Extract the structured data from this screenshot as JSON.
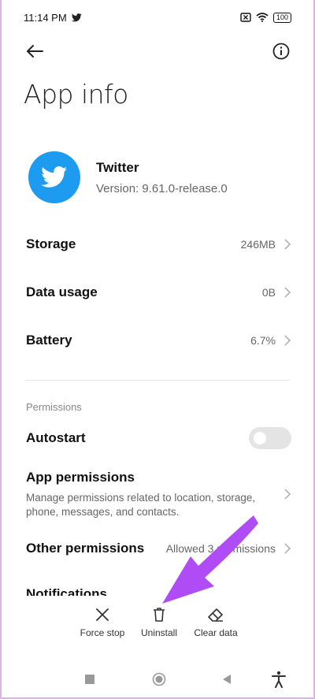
{
  "status_bar": {
    "time": "11:14 PM",
    "battery": "100",
    "icons": [
      "twitter-bird-icon",
      "sim-crossed-icon",
      "wifi-icon",
      "battery-icon"
    ]
  },
  "top_bar": {
    "back_icon": "arrow-left-icon",
    "info_icon": "info-circle-icon"
  },
  "page_title": "App info",
  "app": {
    "name": "Twitter",
    "version": "Version: 9.61.0-release.0",
    "icon": "twitter-bird-icon",
    "icon_color": "#1d9bf0"
  },
  "rows": {
    "storage": {
      "label": "Storage",
      "value": "246MB"
    },
    "data_usage": {
      "label": "Data usage",
      "value": "0B"
    },
    "battery": {
      "label": "Battery",
      "value": "6.7%"
    }
  },
  "permissions": {
    "section_label": "Permissions",
    "autostart": {
      "label": "Autostart",
      "enabled": false
    },
    "app_permissions": {
      "label": "App permissions",
      "subtitle": "Manage permissions related to location, storage, phone, messages, and contacts."
    },
    "other_permissions": {
      "label": "Other permissions",
      "value": "Allowed 3 permissions"
    },
    "notifications": {
      "label": "Notifications"
    }
  },
  "actions": {
    "force_stop": {
      "label": "Force stop",
      "icon": "close-icon"
    },
    "uninstall": {
      "label": "Uninstall",
      "icon": "trash-icon"
    },
    "clear_data": {
      "label": "Clear data",
      "icon": "eraser-icon"
    }
  },
  "nav_bar": {
    "icons": [
      "recents-square-icon",
      "home-circle-icon",
      "back-triangle-icon",
      "accessibility-icon"
    ]
  },
  "annotation": {
    "arrow_color": "#b04cf5"
  }
}
